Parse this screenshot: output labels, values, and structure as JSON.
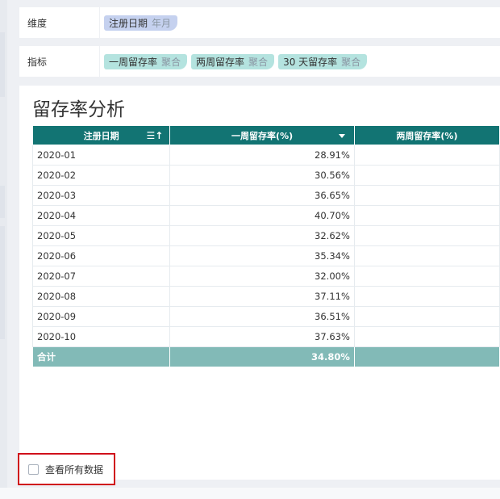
{
  "dimension": {
    "label": "维度",
    "pills": [
      {
        "name": "注册日期",
        "aggregation": "年月"
      }
    ]
  },
  "metrics": {
    "label": "指标",
    "pills": [
      {
        "name": "一周留存率",
        "aggregation": "聚合"
      },
      {
        "name": "两周留存率",
        "aggregation": "聚合"
      },
      {
        "name": "30 天留存率",
        "aggregation": "聚合"
      }
    ]
  },
  "report": {
    "title": "留存率分析",
    "columns": [
      "注册日期",
      "一周留存率(%)",
      "两周留存率(%)"
    ],
    "rows": [
      {
        "date": "2020-01",
        "week1": "28.91%",
        "week2": ""
      },
      {
        "date": "2020-02",
        "week1": "30.56%",
        "week2": ""
      },
      {
        "date": "2020-03",
        "week1": "36.65%",
        "week2": ""
      },
      {
        "date": "2020-04",
        "week1": "40.70%",
        "week2": ""
      },
      {
        "date": "2020-05",
        "week1": "32.62%",
        "week2": ""
      },
      {
        "date": "2020-06",
        "week1": "35.34%",
        "week2": ""
      },
      {
        "date": "2020-07",
        "week1": "32.00%",
        "week2": ""
      },
      {
        "date": "2020-08",
        "week1": "37.11%",
        "week2": ""
      },
      {
        "date": "2020-09",
        "week1": "36.51%",
        "week2": ""
      },
      {
        "date": "2020-10",
        "week1": "37.63%",
        "week2": ""
      }
    ],
    "total": {
      "label": "合计",
      "week1": "34.80%",
      "week2": ""
    }
  },
  "footer": {
    "checkbox_label": "查看所有数据",
    "checked": false
  },
  "colors": {
    "header_bg": "#127473",
    "total_bg": "#82bab7",
    "dim_pill": "#c5d1ef",
    "metric_pill": "#b4e3df",
    "highlight_border": "#d0101b"
  }
}
